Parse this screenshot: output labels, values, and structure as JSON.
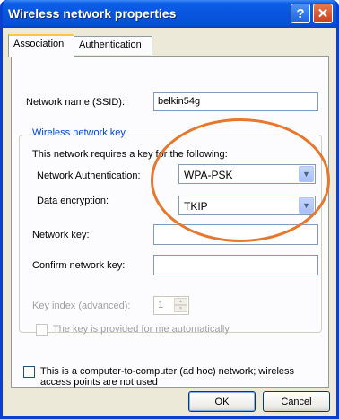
{
  "window": {
    "title": "Wireless network properties",
    "help_glyph": "?",
    "close_glyph": "✕"
  },
  "tabs": [
    {
      "label": "Association",
      "active": true
    },
    {
      "label": "Authentication",
      "active": false
    }
  ],
  "association": {
    "ssid_label": "Network name (SSID):",
    "ssid_value": "belkin54g",
    "group_title": "Wireless network key",
    "requires_text": "This network requires a key for the following:",
    "auth_label": "Network Authentication:",
    "auth_value": "WPA-PSK",
    "encryption_label": "Data encryption:",
    "encryption_value": "TKIP",
    "network_key_label": "Network key:",
    "network_key_value": "",
    "confirm_key_label": "Confirm network key:",
    "confirm_key_value": "",
    "key_index_label": "Key index (advanced):",
    "key_index_value": "1",
    "auto_key_label": "The key is provided for me automatically",
    "adhoc_label_line1": "This is a computer-to-computer (ad hoc) network; wireless",
    "adhoc_label_line2": "access points are not used"
  },
  "buttons": {
    "ok": "OK",
    "cancel": "Cancel"
  },
  "colors": {
    "titlebar": "#0855dd",
    "dialog_bg": "#ece9d8",
    "highlight_ring": "#e8772e",
    "group_title": "#0046d5"
  }
}
